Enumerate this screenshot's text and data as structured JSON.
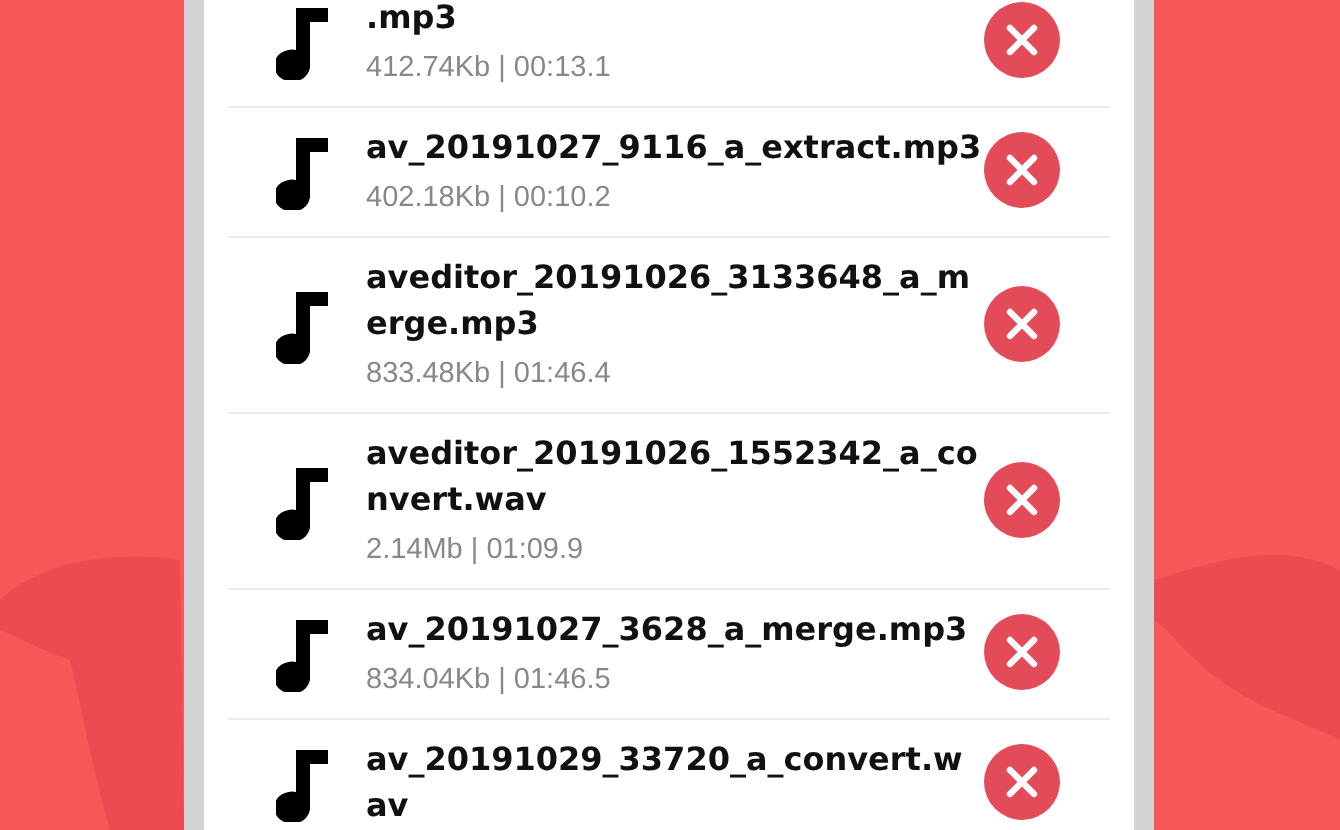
{
  "files": [
    {
      "name": ".mp3",
      "info": "412.74Kb | 00:13.1"
    },
    {
      "name": "av_20191027_9116_a_extract.mp3",
      "info": "402.18Kb | 00:10.2"
    },
    {
      "name": "aveditor_20191026_3133648_a_merge.mp3",
      "info": "833.48Kb | 01:46.4"
    },
    {
      "name": "aveditor_20191026_1552342_a_convert.wav",
      "info": "2.14Mb | 01:09.9"
    },
    {
      "name": "av_20191027_3628_a_merge.mp3",
      "info": "834.04Kb | 01:46.5"
    },
    {
      "name": "av_20191029_33720_a_convert.wav"
    }
  ]
}
